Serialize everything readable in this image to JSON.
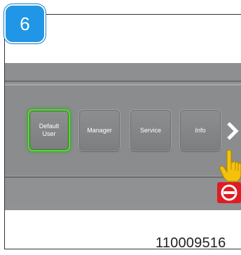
{
  "step": {
    "number": "6"
  },
  "menu": {
    "tiles": [
      {
        "label": "Default User",
        "selected": true
      },
      {
        "label": "Manager",
        "selected": false
      },
      {
        "label": "Service",
        "selected": false
      },
      {
        "label": "Info",
        "selected": false
      }
    ]
  },
  "icons": {
    "next": "chevron-right-icon",
    "hand": "pointing-hand-icon",
    "prohibited": "no-entry-icon"
  },
  "colors": {
    "badge": "#2196e6",
    "selected_outline": "#5cd43a",
    "prohibited": "#e11b22",
    "hand": "#f4c20d"
  },
  "footer": {
    "part_number": "110009516"
  }
}
